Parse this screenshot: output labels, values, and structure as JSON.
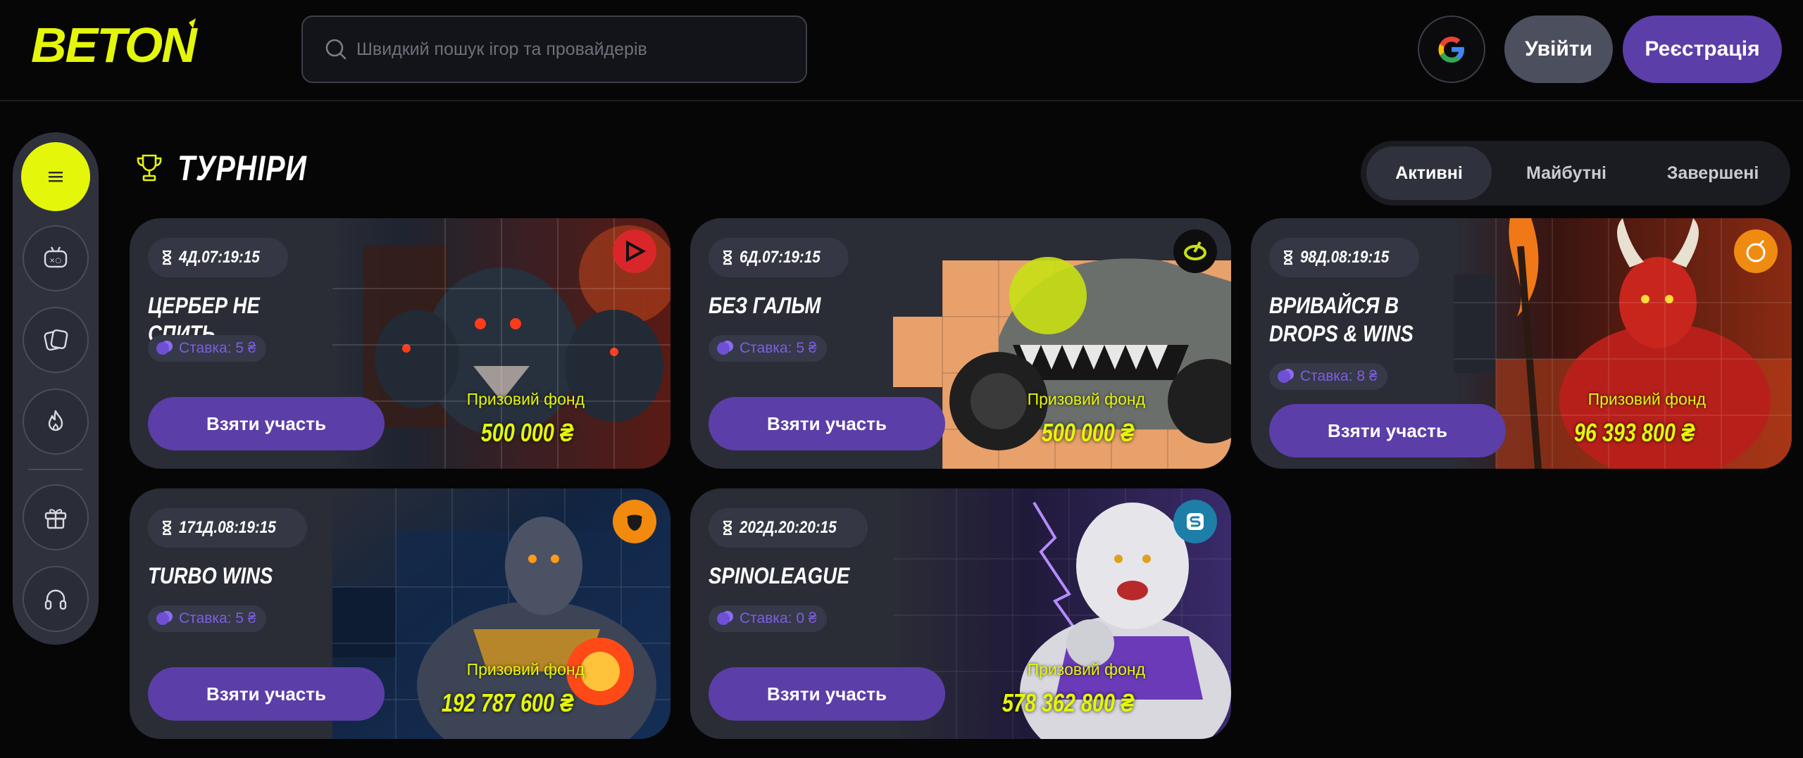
{
  "header": {
    "logo_text": "BETON",
    "search_placeholder": "Швидкий пошук ігор та провайдерів",
    "login_label": "Увійти",
    "register_label": "Реєстрація"
  },
  "sidebar": {
    "items": [
      {
        "icon": "menu-icon"
      },
      {
        "icon": "gamepad-icon"
      },
      {
        "icon": "cards-icon"
      },
      {
        "icon": "fire-icon"
      },
      {
        "icon": "gift-icon"
      },
      {
        "icon": "headset-icon"
      }
    ]
  },
  "tournaments": {
    "title": "ТУРНІРИ",
    "tabs": [
      {
        "label": "Активні",
        "active": true
      },
      {
        "label": "Майбутні",
        "active": false
      },
      {
        "label": "Завершені",
        "active": false
      }
    ],
    "prize_label": "Призовий фонд",
    "join_label": "Взяти участь",
    "cards": [
      {
        "timer": "4Д.07:19:15",
        "title": "ЦЕРБЕР НЕ СПИТЬ",
        "stake": "Ставка: 5 ₴",
        "prize": "500 000 ₴",
        "provider_color": "#d9262b",
        "art_color": "#1d2733"
      },
      {
        "timer": "6Д.07:19:15",
        "title": "БЕЗ ГАЛЬМ",
        "stake": "Ставка: 5 ₴",
        "prize": "500 000 ₴",
        "provider_color": "#0e0e0e",
        "art_color": "#e9a16b"
      },
      {
        "timer": "98Д.08:19:15",
        "title": "ВРИВАЙСЯ В DROPS & WINS",
        "stake": "Ставка: 8 ₴",
        "prize": "96 393 800 ₴",
        "provider_color": "#f08b12",
        "art_color": "#3a1410"
      },
      {
        "timer": "171Д.08:19:15",
        "title": "TURBO WINS",
        "stake": "Ставка: 5 ₴",
        "prize": "192 787 600 ₴",
        "provider_color": "#f28a0e",
        "art_color": "#112441"
      },
      {
        "timer": "202Д.20:20:15",
        "title": "SPINOLEAGUE",
        "stake": "Ставка: 0 ₴",
        "prize": "578 362 800 ₴",
        "provider_color": "#1d7ea8",
        "art_color": "#201a3a"
      }
    ]
  },
  "colors": {
    "accent_yellow": "#e4f60a",
    "primary_purple": "#5b3ea8",
    "card_bg": "#2a2c36"
  }
}
